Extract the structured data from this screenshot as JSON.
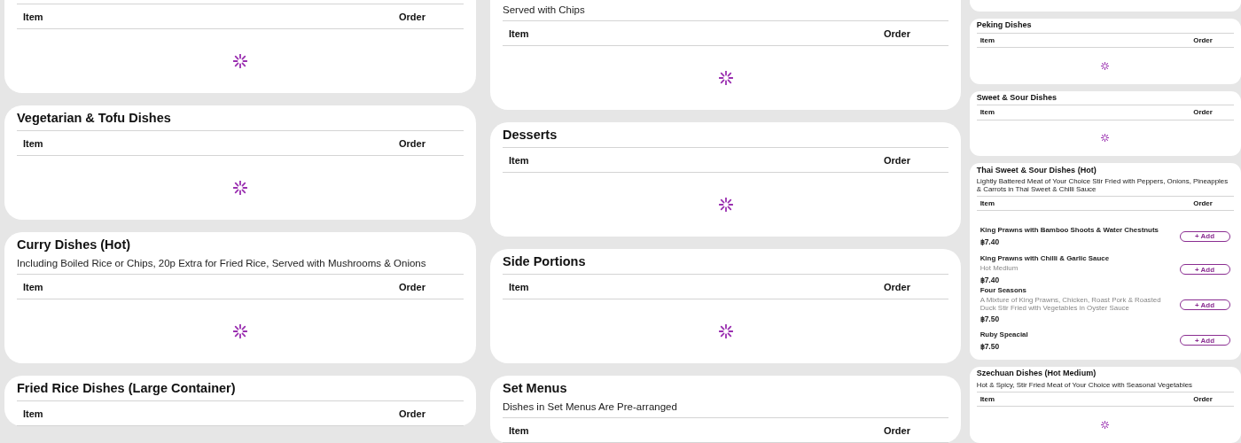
{
  "columns": [
    {
      "sections": [
        {
          "kind": "menu",
          "table_columns": [
            "Item",
            "Order"
          ],
          "loading": true
        },
        {
          "kind": "menu",
          "title": "Vegetarian & Tofu Dishes",
          "table_columns": [
            "Item",
            "Order"
          ],
          "loading": true
        },
        {
          "kind": "menu",
          "title": "Curry Dishes (Hot)",
          "description": "Including Boiled Rice or Chips, 20p Extra for Fried Rice, Served with Mushrooms & Onions",
          "table_columns": [
            "Item",
            "Order"
          ],
          "loading": true
        },
        {
          "kind": "menu",
          "title": "Fried Rice Dishes (Large Container)",
          "table_columns": [
            "Item",
            "Order"
          ]
        }
      ]
    },
    {
      "sections": [
        {
          "kind": "menu",
          "description": "Served with Chips",
          "table_columns": [
            "Item",
            "Order"
          ],
          "loading": true
        },
        {
          "kind": "menu",
          "title": "Desserts",
          "table_columns": [
            "Item",
            "Order"
          ],
          "loading": true
        },
        {
          "kind": "menu",
          "title": "Side Portions",
          "table_columns": [
            "Item",
            "Order"
          ],
          "loading": true
        },
        {
          "kind": "menu",
          "title": "Set Menus",
          "description": "Dishes in Set Menus Are Pre-arranged",
          "table_columns": [
            "Item",
            "Order"
          ]
        }
      ]
    },
    {
      "sections": [
        {
          "kind": "cut"
        },
        {
          "kind": "menu",
          "title": "Peking Dishes",
          "table_columns": [
            "Item",
            "Order"
          ],
          "loading": true
        },
        {
          "kind": "menu",
          "title": "Sweet & Sour Dishes",
          "table_columns": [
            "Item",
            "Order"
          ],
          "loading": true
        },
        {
          "kind": "menu",
          "title": "Thai Sweet & Sour Dishes (Hot)",
          "description": "Lightly Battered Meat of Your Choice Stir Fried with Peppers, Onions, Pineapples & Carrots in Thai Sweet & Chilli Sauce",
          "table_columns": [
            "Item",
            "Order"
          ],
          "loading": false,
          "items": [
            {
              "name": "King Prawns with Bamboo Shoots & Water Chestnuts",
              "price": "฿7.40",
              "add_label": "+ Add"
            },
            {
              "name": "King Prawns with Chilli & Garlic Sauce",
              "description": "Hot Medium",
              "price": "฿7.40",
              "add_label": "+ Add"
            },
            {
              "name": "Four Seasons",
              "description": "A Mixture of King Prawns, Chicken, Roast Pork & Roasted Duck Stir Fried with Vegetables in Oyster Sauce",
              "price": "฿7.50",
              "add_label": "+ Add"
            },
            {
              "name": "Ruby Speacial",
              "price": "฿7.50",
              "add_label": "+ Add"
            }
          ]
        },
        {
          "kind": "menu",
          "title": "Szechuan Dishes (Hot Medium)",
          "description": "Hot & Spicy, Stir Fried Meat of Your Choice with Seasonal Vegetables",
          "table_columns": [
            "Item",
            "Order"
          ],
          "loading": true
        }
      ]
    }
  ]
}
